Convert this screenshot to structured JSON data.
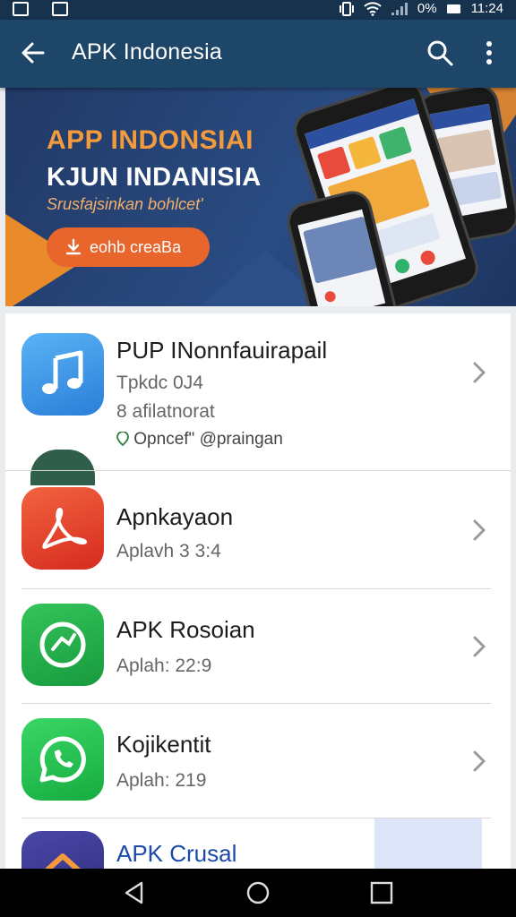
{
  "status_bar": {
    "battery": "0%",
    "time": "11:24"
  },
  "toolbar": {
    "title": "APK Indonesia"
  },
  "banner": {
    "heading": "APP INDONSIAI",
    "subheading": "KJUN INDANISIA",
    "tagline": "Srusfajsinkan bohlcet'",
    "cta_label": "eohb creaBa"
  },
  "apps": [
    {
      "name": "PUP INonnfauirapail",
      "line1": "Tpkdc 0J4",
      "line2": "8 afilatnorat",
      "line3": "Opncef\" @praingan",
      "icon": "music-note-icon",
      "icon_color": "#2f8ee0"
    },
    {
      "name": "Apnkayaon",
      "line1": "Aplavh 3 3:4",
      "icon": "acrobat-icon",
      "icon_color": "#e2412c"
    },
    {
      "name": "APK Rosoian",
      "line1": "Aplah: 22:9",
      "icon": "chat-bubble-icon",
      "icon_color": "#1fa849"
    },
    {
      "name": "Kojikentit",
      "line1": "Aplah: 219",
      "icon": "whatsapp-icon",
      "icon_color": "#1fbf4a"
    },
    {
      "name": "APK Crusal",
      "icon": "house-icon",
      "icon_color": "#3b3a8f"
    }
  ],
  "colors": {
    "toolbar": "#1e4668",
    "status_bar": "#16324d",
    "banner_accent": "#f39a3c",
    "cta": "#e8652c"
  }
}
